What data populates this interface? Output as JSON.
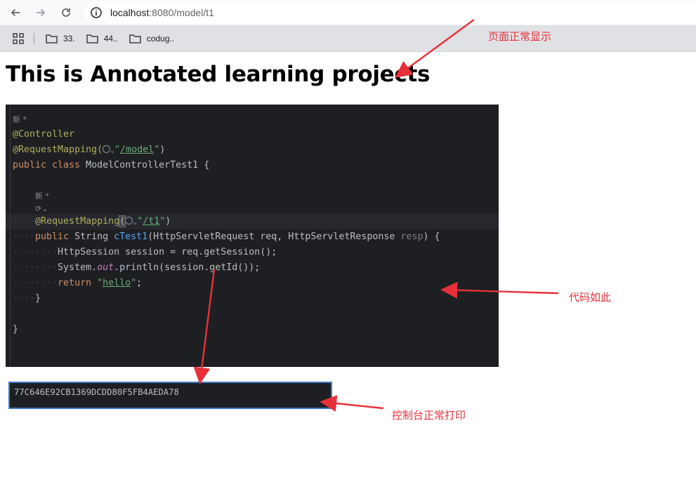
{
  "browser": {
    "url_host": "localhost",
    "url_path": ":8080/model/t1",
    "bookmarks": [
      {
        "label": "33."
      },
      {
        "label": "44.."
      },
      {
        "label": "codug.."
      }
    ]
  },
  "page": {
    "heading": "This is Annotated learning projects"
  },
  "code": {
    "hint_new": "新 *",
    "line_controller": "@Controller",
    "line_reqmap_class_ann": "@RequestMapping(",
    "line_reqmap_class_path": "/model",
    "line_class_kw": "public class",
    "line_class_name": " ModelControllerTest1 {",
    "hint_new2": "新 *",
    "line_reqmap_method_ann": "@RequestMapping",
    "line_reqmap_method_path": "/t1",
    "line_method_kw": "public",
    "line_method_type": " String ",
    "line_method_name": "cTest1",
    "line_method_params": "(HttpServletRequest req, HttpServletResponse ",
    "line_method_unused": "resp",
    "line_method_end": ") {",
    "line_session": "HttpSession session = req.getSession();",
    "line_print_a": "System.",
    "line_print_out": "out",
    "line_print_b": ".println(session.getId());",
    "line_return_kw": "return",
    "line_return_str": "hello",
    "line_close_method": "}",
    "line_close_class": "}"
  },
  "console": {
    "output": "77C646E92CB1369DCDD80F5FB4AEDA78"
  },
  "annotations": {
    "page_ok": "页面正常显示",
    "code_like": "代码如此",
    "console_ok": "控制台正常打印"
  },
  "colors": {
    "annotation_red": "#e8303a",
    "editor_bg": "#1e1f22",
    "console_border": "#3f78c9"
  }
}
